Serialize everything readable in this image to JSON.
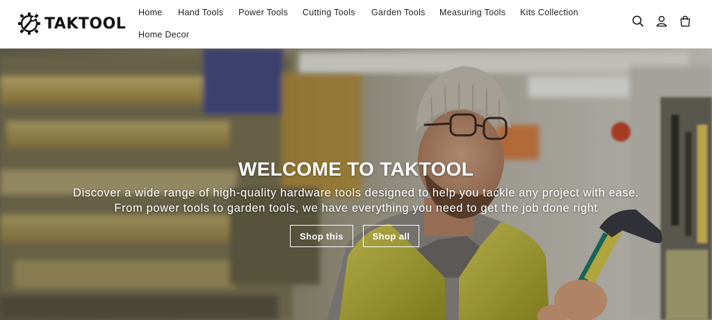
{
  "brand": {
    "name": "TAKTOOL"
  },
  "nav": {
    "items": [
      {
        "label": "Home"
      },
      {
        "label": "Hand Tools"
      },
      {
        "label": "Power Tools"
      },
      {
        "label": "Cutting Tools"
      },
      {
        "label": "Garden Tools"
      },
      {
        "label": "Measuring Tools"
      },
      {
        "label": "Kits Collection"
      },
      {
        "label": "Home Decor"
      }
    ]
  },
  "header_icons": [
    "search-icon",
    "account-icon",
    "cart-icon"
  ],
  "hero": {
    "title": "WELCOME TO TAKTOOL",
    "line1": "Discover a wide range of high-quality hardware tools designed to help you tackle any project with ease.",
    "line2": "From power tools to garden tools, we have everything you need to get the job done right",
    "buttons": [
      {
        "label": "Shop this"
      },
      {
        "label": "Shop all"
      }
    ]
  },
  "colors": {
    "accent_vest": "#c9c23a",
    "text": "#121212",
    "white": "#ffffff"
  }
}
